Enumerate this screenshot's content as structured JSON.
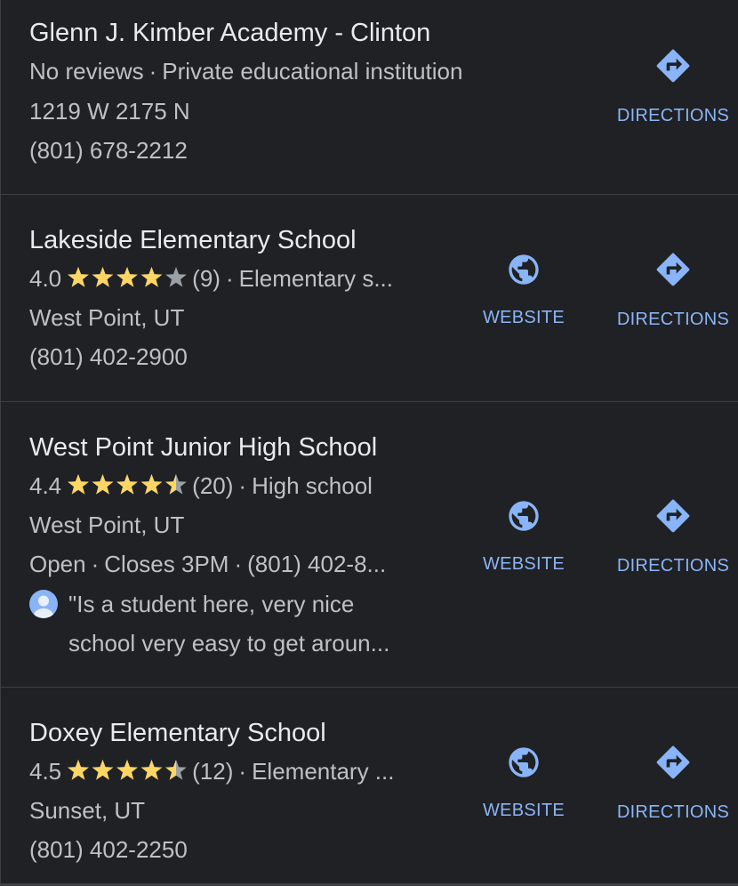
{
  "results": [
    {
      "name": "Glenn J. Kimber Academy - Clinton",
      "reviews_text": "No reviews",
      "category": "Private educational institution",
      "address": "1219 W 2175 N",
      "phone": "(801) 678-2212",
      "directions_label": "DIRECTIONS"
    },
    {
      "name": "Lakeside Elementary School",
      "rating": "4.0",
      "rating_value": 4.0,
      "review_count": "(9)",
      "category": "Elementary s...",
      "address": "West Point, UT",
      "phone": "(801) 402-2900",
      "website_label": "WEBSITE",
      "directions_label": "DIRECTIONS"
    },
    {
      "name": "West Point Junior High School",
      "rating": "4.4",
      "rating_value": 4.4,
      "review_count": "(20)",
      "category": "High school",
      "address": "West Point, UT",
      "status": "Open",
      "hours": "Closes 3PM",
      "phone": "(801) 402-8...",
      "review_line1": "\"Is a student here, very nice",
      "review_line2": "school very easy to get aroun...",
      "website_label": "WEBSITE",
      "directions_label": "DIRECTIONS"
    },
    {
      "name": "Doxey Elementary School",
      "rating": "4.5",
      "rating_value": 4.5,
      "review_count": "(12)",
      "category": "Elementary ...",
      "address": "Sunset, UT",
      "phone": "(801) 402-2250",
      "website_label": "WEBSITE",
      "directions_label": "DIRECTIONS"
    }
  ],
  "separator": "·",
  "colors": {
    "background": "#202124",
    "title_text": "#e8eaed",
    "secondary_text": "#bdc1c6",
    "accent": "#8ab4f8",
    "star_filled": "#fdd663",
    "star_empty": "#9aa0a6",
    "divider": "#3c4043"
  },
  "icons": {
    "website": "globe-icon",
    "directions": "directions-icon",
    "reviewer": "avatar-icon",
    "star": "star-icon"
  }
}
